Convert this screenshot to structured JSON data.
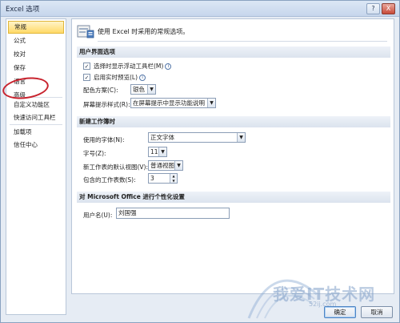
{
  "window": {
    "title": "Excel 选项",
    "help": "?",
    "close": "X"
  },
  "sidebar": {
    "items": [
      {
        "label": "常规"
      },
      {
        "label": "公式"
      },
      {
        "label": "校对"
      },
      {
        "label": "保存"
      },
      {
        "label": "语言"
      },
      {
        "label": "高级"
      },
      {
        "label": "自定义功能区"
      },
      {
        "label": "快速访问工具栏"
      },
      {
        "label": "加载项"
      },
      {
        "label": "信任中心"
      }
    ],
    "selected": "常规"
  },
  "header": {
    "text": "使用 Excel 时采用的常规选项。"
  },
  "ui_options": {
    "section_title": "用户界面选项",
    "mini_toolbar": {
      "label": "选择时显示浮动工具栏(M)",
      "checked": true
    },
    "live_preview": {
      "label": "启用实时预览(L)",
      "checked": true
    },
    "color_scheme": {
      "label": "配色方案(C):",
      "value": "银色"
    },
    "tooltip_style": {
      "label": "屏幕提示样式(R):",
      "value": "在屏幕提示中显示功能说明"
    }
  },
  "new_workbook": {
    "section_title": "新建工作簿时",
    "font": {
      "label": "使用的字体(N):",
      "value": "正文字体"
    },
    "font_size": {
      "label": "字号(Z):",
      "value": "11"
    },
    "default_view": {
      "label": "新工作表的默认视图(V):",
      "value": "普通视图"
    },
    "sheet_count": {
      "label": "包含的工作表数(S):",
      "value": "3"
    }
  },
  "personalize": {
    "section_title": "对 Microsoft Office 进行个性化设置",
    "username": {
      "label": "用户名(U):",
      "value": "刘国强"
    }
  },
  "buttons": {
    "ok": "确定",
    "cancel": "取消"
  },
  "watermark": {
    "text": "我爱IT技术网",
    "sub": "52ij.com"
  },
  "colors": {
    "accent": "#ffd966",
    "highlight_circle": "#c8232e",
    "section_bg": "#dbe3ee"
  },
  "icons": {
    "check": "✓",
    "info": "i",
    "arrow": "▼",
    "spin_up": "▲",
    "spin_down": "▼"
  }
}
